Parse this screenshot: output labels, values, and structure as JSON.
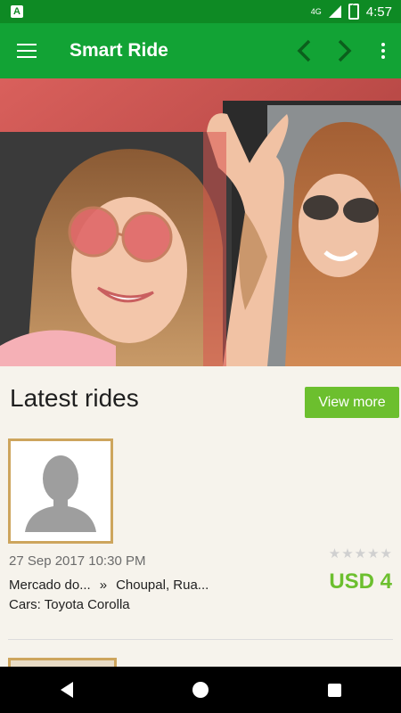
{
  "status_bar": {
    "network": "4G",
    "time": "4:57"
  },
  "app_bar": {
    "title": "Smart Ride",
    "menu_icon": "hamburger-icon",
    "prev_icon": "chevron-left-icon",
    "next_icon": "chevron-right-icon",
    "overflow_icon": "more-vertical-icon"
  },
  "latest_rides": {
    "title": "Latest rides",
    "view_more_label": "View more",
    "rides": [
      {
        "date": "27 Sep 2017 10:30 PM",
        "from": "Mercado do...",
        "separator": "»",
        "to": "Choupal, Rua...",
        "cars_label": "Cars: Toyota Corolla",
        "price": "USD 4",
        "rating": 0,
        "rating_max": 5
      }
    ]
  },
  "colors": {
    "status_bar": "#0e8a24",
    "app_bar": "#12a335",
    "accent_green": "#6cbf2e",
    "avatar_border": "#cda55d",
    "background": "#f6f3ec"
  }
}
